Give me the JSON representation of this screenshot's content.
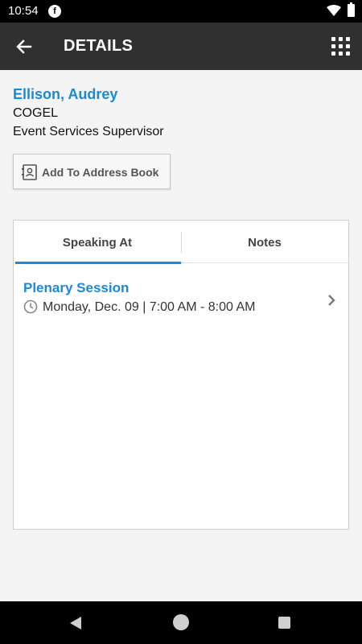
{
  "status_bar": {
    "time": "10:54"
  },
  "app_bar": {
    "title": "DETAILS"
  },
  "person": {
    "name": "Ellison, Audrey",
    "organization": "COGEL",
    "job_title": "Event Services Supervisor"
  },
  "actions": {
    "add_to_address_book": "Add To Address Book"
  },
  "tabs": [
    {
      "label": "Speaking At",
      "selected": true
    },
    {
      "label": "Notes",
      "selected": false
    }
  ],
  "sessions": [
    {
      "title": "Plenary Session",
      "time": "Monday, Dec. 09 | 7:00 AM - 8:00 AM"
    }
  ],
  "colors": {
    "accent": "#1a8ad6",
    "app_bar": "#303030"
  }
}
